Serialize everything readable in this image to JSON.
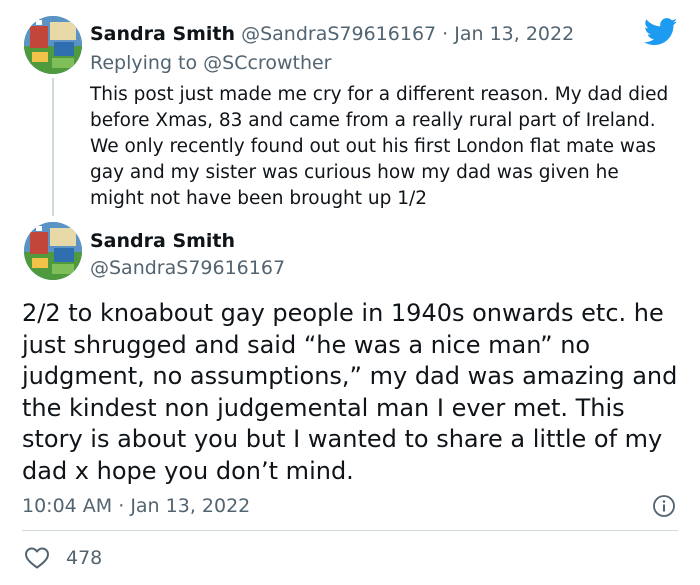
{
  "reply_tweet": {
    "display_name": "Sandra Smith",
    "handle": "@SandraS79616167",
    "separator": " · ",
    "date": "Jan 13, 2022",
    "replying_prefix": "Replying to ",
    "replying_to": "@SCcrowther",
    "text": "This post just made me cry for a different reason. My dad died before Xmas, 83 and came from a really rural part of Ireland. We only recently found out out his first London flat mate was gay and my sister was curious how my dad was given he might not have been brought up 1/2"
  },
  "main_tweet": {
    "display_name": "Sandra Smith",
    "handle": "@SandraS79616167",
    "text": "2/2 to knoabout gay people in 1940s onwards etc. he just shrugged and said “he was a nice man” no judgment, no assumptions,” my dad was amazing and the kindest non judgemental man I ever met. This story is about you but I wanted to share a little of my dad x hope you don’t mind.",
    "time": "10:04 AM",
    "separator": " · ",
    "date": "Jan 13, 2022",
    "like_count": "478"
  },
  "icons": {
    "brand": "twitter-bird-icon",
    "info": "info-icon",
    "like": "heart-icon"
  },
  "colors": {
    "brand_blue": "#1d9bf0",
    "text_primary": "#0f1419",
    "text_secondary": "#536471",
    "border": "#cfd9de"
  }
}
